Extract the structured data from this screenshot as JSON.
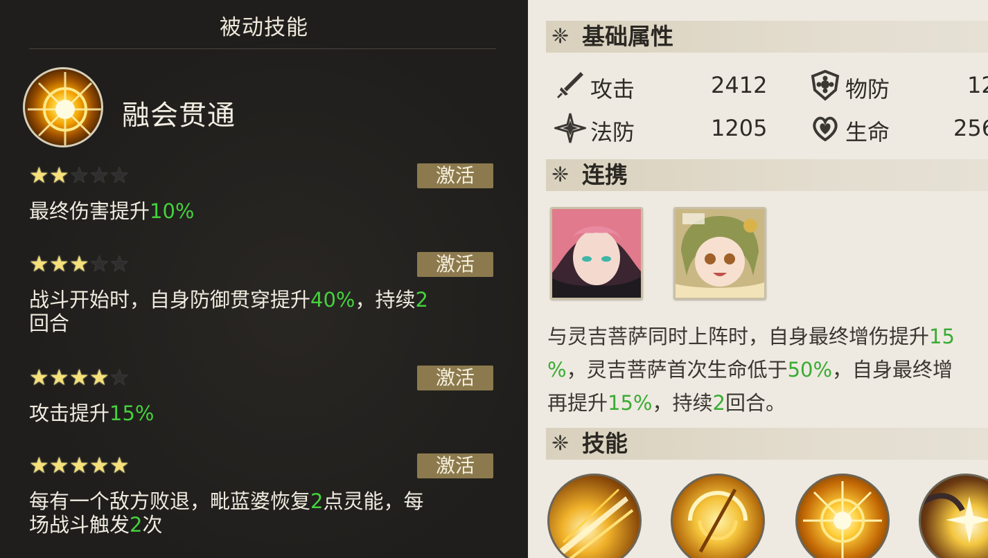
{
  "passive": {
    "title": "被动技能",
    "skill_name": "融会贯通",
    "tiers": [
      {
        "stars_on": 2,
        "stars_total": 5,
        "button": "激活",
        "parts": [
          "最终伤害提升",
          "10%",
          "",
          "",
          ""
        ]
      },
      {
        "stars_on": 3,
        "stars_total": 5,
        "button": "激活",
        "parts": [
          "战斗开始时，自身防御贯穿提升",
          "40%",
          "，持续",
          "2",
          "回合"
        ]
      },
      {
        "stars_on": 4,
        "stars_total": 5,
        "button": "激活",
        "parts": [
          "攻击提升",
          "15%",
          "",
          "",
          ""
        ]
      },
      {
        "stars_on": 5,
        "stars_total": 5,
        "button": "激活",
        "parts": [
          "每有一个敌方败退，毗蓝婆恢复",
          "2",
          "点灵能，每场战斗触发",
          "2",
          "次"
        ]
      }
    ]
  },
  "base_attributes": {
    "title": "基础属性",
    "items": [
      {
        "icon": "sword-icon",
        "label": "攻击",
        "value": "2412"
      },
      {
        "icon": "shield-flower-icon",
        "label": "物防",
        "value": "12"
      },
      {
        "icon": "magic-defense-icon",
        "label": "法防",
        "value": "1205"
      },
      {
        "icon": "heart-life-icon",
        "label": "生命",
        "value": "256"
      }
    ]
  },
  "combo": {
    "title": "连携",
    "portraits": [
      {
        "icon": "portrait-pink-hair-icon"
      },
      {
        "icon": "portrait-green-hair-icon"
      }
    ],
    "desc_parts": [
      "与灵吉菩萨同时上阵时，自身最终增伤提升",
      "15\n%",
      "，灵吉菩萨首次生命低于",
      "50%",
      "，自身最终增\n再提升",
      "15%",
      "，持续",
      "2",
      "回合。"
    ]
  },
  "skills": {
    "title": "技能",
    "icons": [
      "skill-slash-icon",
      "skill-vortex-icon",
      "skill-sun-icon",
      "skill-star-burst-icon"
    ]
  },
  "colors": {
    "highlight_dark": "#44d23c",
    "highlight_light": "#3aab34",
    "button_gold": "#8c7a4e",
    "panel_dark": "#1f1e1c",
    "panel_light": "#eeeae1"
  }
}
